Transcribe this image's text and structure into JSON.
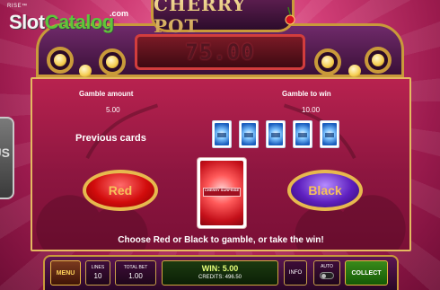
{
  "brand": {
    "small": "RISE™",
    "slot": "Slot",
    "catalog": "Catalog",
    "com": ".com"
  },
  "game": {
    "title": "CHERRY POT",
    "win_display": "75.00"
  },
  "gamble": {
    "gamble_amount_label": "Gamble amount",
    "gamble_amount_value": "5.00",
    "gamble_to_win_label": "Gamble to win",
    "gamble_to_win_value": "10.00",
    "previous_cards_label": "Previous cards",
    "red_label": "Red",
    "black_label": "Black",
    "message": "Choose Red or Black to gamble, or take the win!",
    "card_band_text": "CHERRY SURPRISE",
    "previous_cards": [
      "blue-card-back",
      "blue-card-back",
      "blue-card-back",
      "blue-card-back",
      "blue-card-back"
    ]
  },
  "side": {
    "text": "US"
  },
  "bottom_bar": {
    "menu_label": "MENU",
    "lines_label": "LINES",
    "lines_value": "10",
    "total_bet_label": "TOTAL BET",
    "total_bet_value": "1.00",
    "win_label": "WIN: 5.00",
    "credits_label": "CREDITS: 496.50",
    "info_label": "INFO",
    "auto_label": "AUTO",
    "collect_label": "COLLECT"
  },
  "colors": {
    "background": "#b8235e",
    "gold_border": "#c99a3a",
    "red_button": "#d20c0c",
    "black_button": "#5e1fbf",
    "win_text": "#e7ff7a"
  }
}
